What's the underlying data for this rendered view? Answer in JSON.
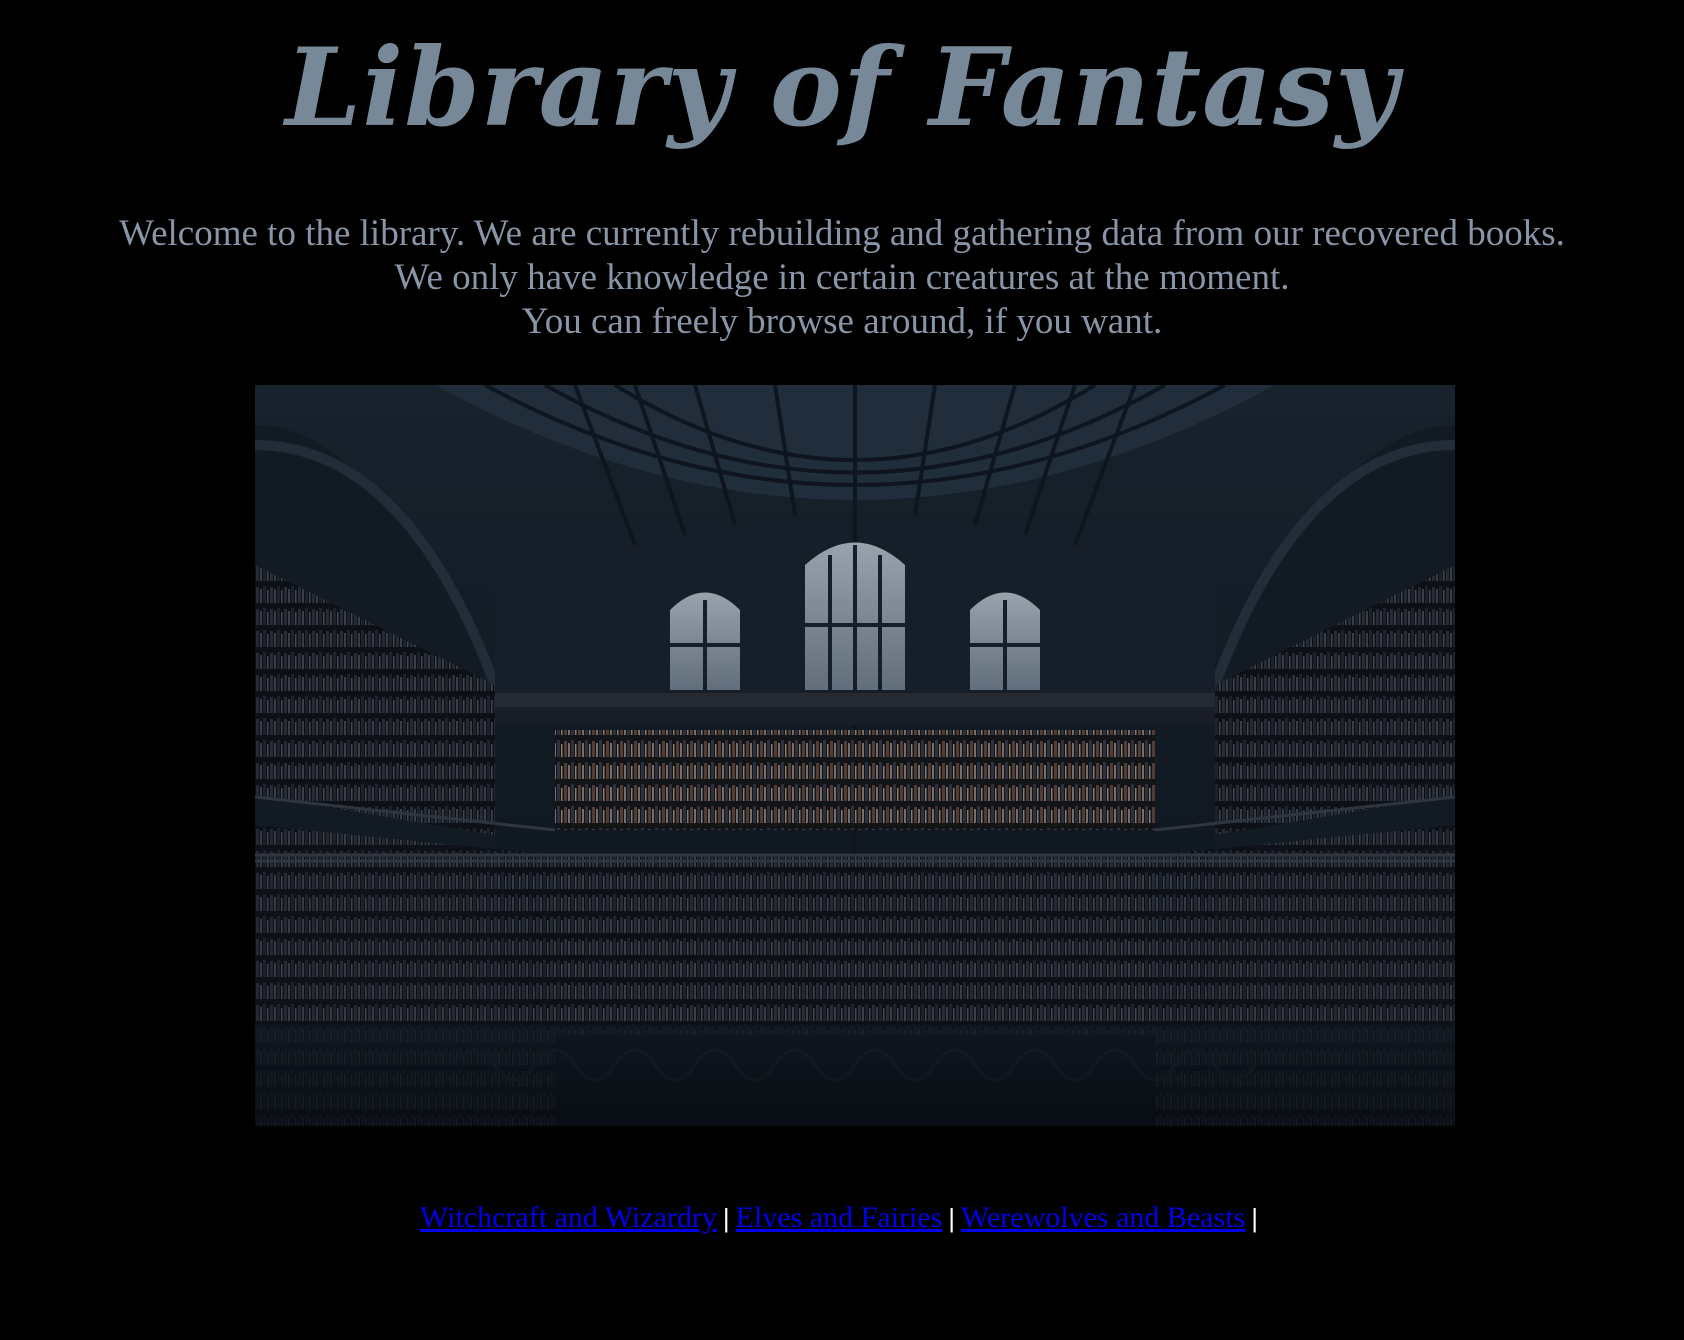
{
  "header": {
    "title": "Library of Fantasy"
  },
  "intro": {
    "lines": [
      "Welcome to the library. We are currently rebuilding and gathering data from our recovered books.",
      "We only have knowledge in certain creatures at the moment.",
      "You can freely browse around, if you want."
    ]
  },
  "nav": {
    "links": [
      {
        "label": "Witchcraft and Wizardry"
      },
      {
        "label": "Elves and Fairies"
      },
      {
        "label": "Werewolves and Beasts"
      }
    ],
    "separator": "|"
  },
  "colors": {
    "background": "#000000",
    "title": "#778899",
    "intro_text": "#8895a6",
    "link": "#0000ee",
    "separator": "#ffffff"
  }
}
